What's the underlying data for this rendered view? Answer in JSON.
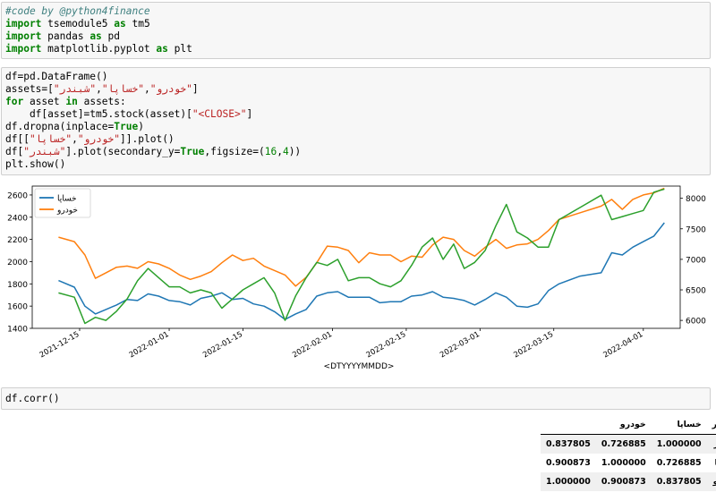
{
  "cells": [
    {
      "lines": [
        [
          {
            "t": "#code by @python4finance",
            "c": "cm"
          }
        ],
        [
          {
            "t": "import",
            "c": "kw"
          },
          {
            "t": " tsemodule5 "
          },
          {
            "t": "as",
            "c": "kw"
          },
          {
            "t": " tm5"
          }
        ],
        [
          {
            "t": "import",
            "c": "kw"
          },
          {
            "t": " pandas "
          },
          {
            "t": "as",
            "c": "kw"
          },
          {
            "t": " pd"
          }
        ],
        [
          {
            "t": "import",
            "c": "kw"
          },
          {
            "t": " matplotlib.pyplot "
          },
          {
            "t": "as",
            "c": "kw"
          },
          {
            "t": " plt"
          }
        ]
      ]
    },
    {
      "lines": [
        [
          {
            "t": "df=pd.DataFrame()"
          }
        ],
        [
          {
            "t": "assets=["
          },
          {
            "t": "\"خودرو\"",
            "c": "st"
          },
          {
            "t": ","
          },
          {
            "t": "\"خساپا\"",
            "c": "st"
          },
          {
            "t": ","
          },
          {
            "t": "\"شبندر\"",
            "c": "st"
          },
          {
            "t": "]"
          }
        ],
        [
          {
            "t": "for",
            "c": "kw"
          },
          {
            "t": " asset "
          },
          {
            "t": "in",
            "c": "kw"
          },
          {
            "t": " assets:"
          }
        ],
        [
          {
            "t": "    df[asset]=tm5.stock(asset)["
          },
          {
            "t": "\"<CLOSE>\"",
            "c": "st"
          },
          {
            "t": "]"
          }
        ],
        [
          {
            "t": "df.dropna(inplace="
          },
          {
            "t": "True",
            "c": "kw"
          },
          {
            "t": ")"
          }
        ],
        [
          {
            "t": "df[["
          },
          {
            "t": "\"خودرو\"",
            "c": "st"
          },
          {
            "t": ","
          },
          {
            "t": "\"خساپا\"",
            "c": "st"
          },
          {
            "t": "]].plot()"
          }
        ],
        [
          {
            "t": "df["
          },
          {
            "t": "\"شبندر\"",
            "c": "st"
          },
          {
            "t": "].plot(secondary_y="
          },
          {
            "t": "True",
            "c": "kw"
          },
          {
            "t": ",figsize=("
          },
          {
            "t": "16",
            "c": "nm"
          },
          {
            "t": ","
          },
          {
            "t": "4",
            "c": "nm"
          },
          {
            "t": "))"
          }
        ],
        [
          {
            "t": "plt.show()"
          }
        ]
      ]
    },
    {
      "lines": [
        [
          {
            "t": "df.corr()"
          }
        ]
      ]
    }
  ],
  "chart_data": {
    "type": "line",
    "xlabel": "<DTYYYYMMDD>",
    "x_ticks": [
      "2021-12-15",
      "2022-01-01",
      "2022-01-15",
      "2022-02-01",
      "2022-02-15",
      "2022-03-01",
      "2022-03-15",
      "2022-04-01"
    ],
    "y_left_ticks": [
      1400,
      1600,
      1800,
      2000,
      2200,
      2400,
      2600
    ],
    "y_right_ticks": [
      6000,
      6500,
      7000,
      7500,
      8000
    ],
    "ylim_left": [
      1400,
      2680
    ],
    "ylim_right": [
      5870,
      8200
    ],
    "xlim": [
      "2021-12-06",
      "2022-04-08"
    ],
    "legend_position": "upper-left",
    "legend": [
      "خساپا",
      "خودرو"
    ],
    "series": [
      {
        "name": "خساپا",
        "axis": "left",
        "color": "#1f77b4",
        "x": [
          "2021-12-11",
          "2021-12-14",
          "2021-12-16",
          "2021-12-18",
          "2021-12-20",
          "2021-12-22",
          "2021-12-24",
          "2021-12-26",
          "2021-12-28",
          "2021-12-30",
          "2022-01-01",
          "2022-01-03",
          "2022-01-05",
          "2022-01-07",
          "2022-01-09",
          "2022-01-11",
          "2022-01-13",
          "2022-01-15",
          "2022-01-17",
          "2022-01-19",
          "2022-01-21",
          "2022-01-23",
          "2022-01-25",
          "2022-01-27",
          "2022-01-29",
          "2022-01-31",
          "2022-02-02",
          "2022-02-04",
          "2022-02-06",
          "2022-02-08",
          "2022-02-10",
          "2022-02-12",
          "2022-02-14",
          "2022-02-16",
          "2022-02-18",
          "2022-02-20",
          "2022-02-22",
          "2022-02-24",
          "2022-02-26",
          "2022-02-28",
          "2022-03-02",
          "2022-03-04",
          "2022-03-06",
          "2022-03-08",
          "2022-03-10",
          "2022-03-12",
          "2022-03-14",
          "2022-03-16",
          "2022-03-20",
          "2022-03-24",
          "2022-03-26",
          "2022-03-28",
          "2022-03-30",
          "2022-04-01",
          "2022-04-03",
          "2022-04-05"
        ],
        "values": [
          1830,
          1770,
          1600,
          1530,
          1570,
          1610,
          1660,
          1650,
          1710,
          1690,
          1650,
          1640,
          1610,
          1670,
          1690,
          1720,
          1660,
          1670,
          1620,
          1600,
          1550,
          1480,
          1530,
          1570,
          1690,
          1720,
          1730,
          1680,
          1680,
          1680,
          1630,
          1640,
          1640,
          1690,
          1700,
          1730,
          1680,
          1670,
          1650,
          1610,
          1660,
          1720,
          1680,
          1600,
          1590,
          1620,
          1740,
          1800,
          1870,
          1900,
          2080,
          2060,
          2130,
          2180,
          2230,
          2350
        ]
      },
      {
        "name": "خودرو",
        "axis": "left",
        "color": "#ff7f0e",
        "x": [
          "2021-12-11",
          "2021-12-14",
          "2021-12-16",
          "2021-12-18",
          "2021-12-20",
          "2021-12-22",
          "2021-12-24",
          "2021-12-26",
          "2021-12-28",
          "2021-12-30",
          "2022-01-01",
          "2022-01-03",
          "2022-01-05",
          "2022-01-07",
          "2022-01-09",
          "2022-01-11",
          "2022-01-13",
          "2022-01-15",
          "2022-01-17",
          "2022-01-19",
          "2022-01-21",
          "2022-01-23",
          "2022-01-25",
          "2022-01-27",
          "2022-01-29",
          "2022-01-31",
          "2022-02-02",
          "2022-02-04",
          "2022-02-06",
          "2022-02-08",
          "2022-02-10",
          "2022-02-12",
          "2022-02-14",
          "2022-02-16",
          "2022-02-18",
          "2022-02-20",
          "2022-02-22",
          "2022-02-24",
          "2022-02-26",
          "2022-02-28",
          "2022-03-02",
          "2022-03-04",
          "2022-03-06",
          "2022-03-08",
          "2022-03-10",
          "2022-03-12",
          "2022-03-14",
          "2022-03-16",
          "2022-03-20",
          "2022-03-24",
          "2022-03-26",
          "2022-03-28",
          "2022-03-30",
          "2022-04-01",
          "2022-04-03",
          "2022-04-05"
        ],
        "values": [
          2220,
          2180,
          2060,
          1850,
          1900,
          1950,
          1960,
          1940,
          2000,
          1980,
          1940,
          1880,
          1840,
          1870,
          1910,
          1990,
          2060,
          2010,
          2030,
          1960,
          1920,
          1880,
          1780,
          1860,
          1990,
          2140,
          2130,
          2100,
          1990,
          2080,
          2060,
          2060,
          2000,
          2050,
          2040,
          2150,
          2220,
          2200,
          2100,
          2050,
          2130,
          2200,
          2120,
          2150,
          2160,
          2200,
          2280,
          2380,
          2440,
          2500,
          2560,
          2470,
          2560,
          2600,
          2620,
          2660
        ]
      },
      {
        "name": "شبندر",
        "axis": "right",
        "color": "#2ca02c",
        "x": [
          "2021-12-11",
          "2021-12-14",
          "2021-12-16",
          "2021-12-18",
          "2021-12-20",
          "2021-12-22",
          "2021-12-24",
          "2021-12-26",
          "2021-12-28",
          "2021-12-30",
          "2022-01-01",
          "2022-01-03",
          "2022-01-05",
          "2022-01-07",
          "2022-01-09",
          "2022-01-11",
          "2022-01-13",
          "2022-01-15",
          "2022-01-17",
          "2022-01-19",
          "2022-01-21",
          "2022-01-23",
          "2022-01-25",
          "2022-01-27",
          "2022-01-29",
          "2022-01-31",
          "2022-02-02",
          "2022-02-04",
          "2022-02-06",
          "2022-02-08",
          "2022-02-10",
          "2022-02-12",
          "2022-02-14",
          "2022-02-16",
          "2022-02-18",
          "2022-02-20",
          "2022-02-22",
          "2022-02-24",
          "2022-02-26",
          "2022-02-28",
          "2022-03-02",
          "2022-03-04",
          "2022-03-06",
          "2022-03-08",
          "2022-03-10",
          "2022-03-12",
          "2022-03-14",
          "2022-03-16",
          "2022-03-20",
          "2022-03-24",
          "2022-03-26",
          "2022-03-28",
          "2022-03-30",
          "2022-04-01",
          "2022-04-03",
          "2022-04-05"
        ],
        "values": [
          6450,
          6380,
          5950,
          6050,
          6000,
          6150,
          6350,
          6650,
          6850,
          6700,
          6550,
          6550,
          6450,
          6500,
          6450,
          6200,
          6350,
          6500,
          6600,
          6700,
          6450,
          6000,
          6400,
          6700,
          6950,
          6900,
          7000,
          6650,
          6700,
          6700,
          6600,
          6550,
          6650,
          6900,
          7200,
          7350,
          7000,
          7250,
          6850,
          6950,
          7150,
          7550,
          7900,
          7450,
          7350,
          7200,
          7200,
          7650,
          7850,
          8050,
          7650,
          7700,
          7750,
          7800,
          8100,
          8150
        ]
      }
    ]
  },
  "corr_table": {
    "headers": [
      "خودرو",
      "خساپا",
      "شبندر"
    ],
    "rows": [
      {
        "label": "شبندر",
        "values": [
          "0.837805",
          "0.726885",
          "1.000000"
        ]
      },
      {
        "label": "خساپا",
        "values": [
          "0.900873",
          "1.000000",
          "0.726885"
        ]
      },
      {
        "label": "خودرو",
        "values": [
          "1.000000",
          "0.900873",
          "0.837805"
        ]
      }
    ]
  }
}
